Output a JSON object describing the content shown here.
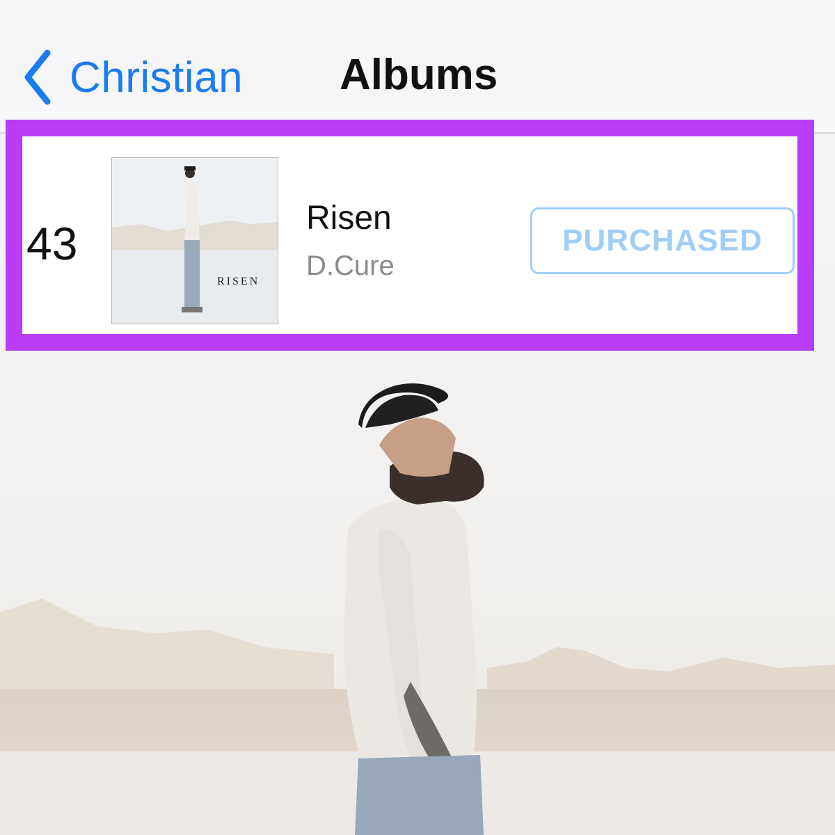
{
  "nav": {
    "back_label": "Christian",
    "title": "Albums"
  },
  "album_row": {
    "rank": "43",
    "cover_text": "RISEN",
    "title": "Risen",
    "artist": "D.Cure",
    "status_label": "PURCHASED"
  },
  "colors": {
    "accent": "#1a7cf0",
    "highlight_border": "#b93cf6",
    "purchased": "#9fcdf6"
  }
}
